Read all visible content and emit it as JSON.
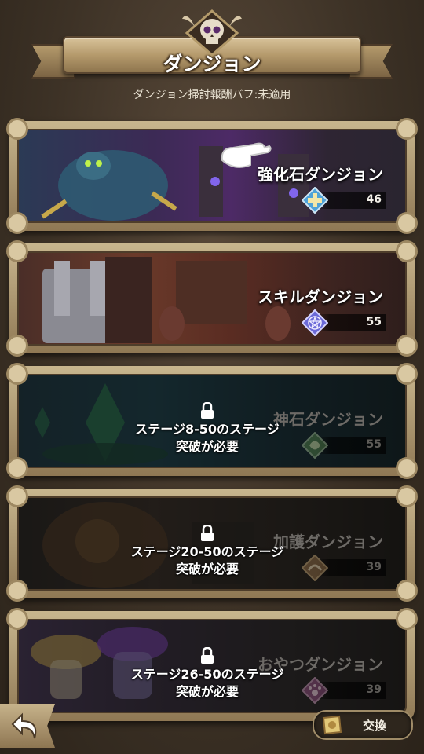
{
  "header": {
    "title": "ダンジョン",
    "buff_status": "ダンジョン掃討報酬バフ:未適用"
  },
  "dungeons": [
    {
      "name": "強化石ダンジョン",
      "value": "46",
      "locked": false,
      "gem_color": "#4fa3d8",
      "gem_icon": "plus-gem-icon"
    },
    {
      "name": "スキルダンジョン",
      "value": "55",
      "locked": false,
      "gem_color": "#6c6ad8",
      "gem_icon": "pentagram-gem-icon"
    },
    {
      "name": "神石ダンジョン",
      "value": "55",
      "locked": true,
      "lock_line1": "ステージ8-50のステージ",
      "lock_line2": "突破が必要",
      "gem_color": "#4e7a46",
      "gem_icon": "spirit-gem-icon"
    },
    {
      "name": "加護ダンジョン",
      "value": "39",
      "locked": true,
      "lock_line1": "ステージ20-50のステージ",
      "lock_line2": "突破が必要",
      "gem_color": "#8c6a44",
      "gem_icon": "blessing-gem-icon"
    },
    {
      "name": "おやつダンジョン",
      "value": "39",
      "locked": true,
      "lock_line1": "ステージ26-50のステージ",
      "lock_line2": "突破が必要",
      "gem_color": "#8a4a7a",
      "gem_icon": "paw-gem-icon"
    }
  ],
  "footer": {
    "back_icon": "back-arrow-icon",
    "exchange_label": "交換",
    "exchange_icon": "exchange-token-icon"
  }
}
